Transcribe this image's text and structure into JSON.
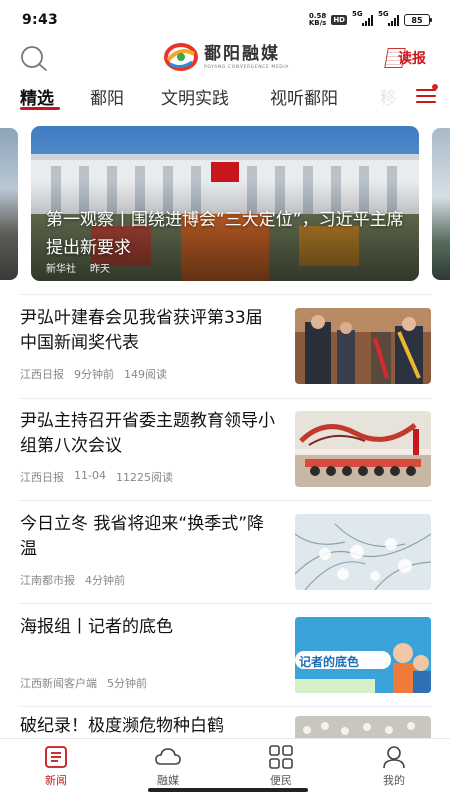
{
  "status_bar": {
    "time": "9:43",
    "net_speed_value": "0.58",
    "net_speed_unit": "KB/s",
    "hd_badge": "HD",
    "signal_1": "5G",
    "signal_2": "5G",
    "battery": "85"
  },
  "header": {
    "logo_cn": "鄱阳融媒",
    "logo_en": "POYANG CONVERGENCE MEDIA",
    "dubao_label": "读报"
  },
  "tabs": [
    {
      "label": "精选",
      "active": true
    },
    {
      "label": "鄱阳"
    },
    {
      "label": "文明实践"
    },
    {
      "label": "视听鄱阳"
    },
    {
      "label": "移"
    }
  ],
  "carousel": {
    "caption": "第一观察丨围绕进博会“三大定位”，习近平主席提出新要求",
    "source": "新华社",
    "time": "昨天"
  },
  "news": [
    {
      "title": "尹弘叶建春会见我省获评第33届中国新闻奖代表",
      "source": "江西日报",
      "time": "9分钟前",
      "reads": "149阅读"
    },
    {
      "title": "尹弘主持召开省委主题教育领导小组第八次会议",
      "source": "江西日报",
      "time": "11-04",
      "reads": "11225阅读"
    },
    {
      "title": "今日立冬 我省将迎来“换季式”降温",
      "source": "江南都市报",
      "time": "4分钟前",
      "reads": ""
    },
    {
      "title": "海报组丨记者的底色",
      "source": "江西新闻客户端",
      "time": "5分钟前",
      "reads": "",
      "thumb_text": "记者的底色"
    },
    {
      "title": "破纪录！极度濒危物种白鹤",
      "source": "",
      "time": "",
      "reads": ""
    }
  ],
  "bottom_nav": [
    {
      "label": "新闻",
      "active": true
    },
    {
      "label": "融媒"
    },
    {
      "label": "便民"
    },
    {
      "label": "我的"
    }
  ],
  "colors": {
    "accent": "#c8161d",
    "text": "#111111",
    "meta": "#888888"
  }
}
